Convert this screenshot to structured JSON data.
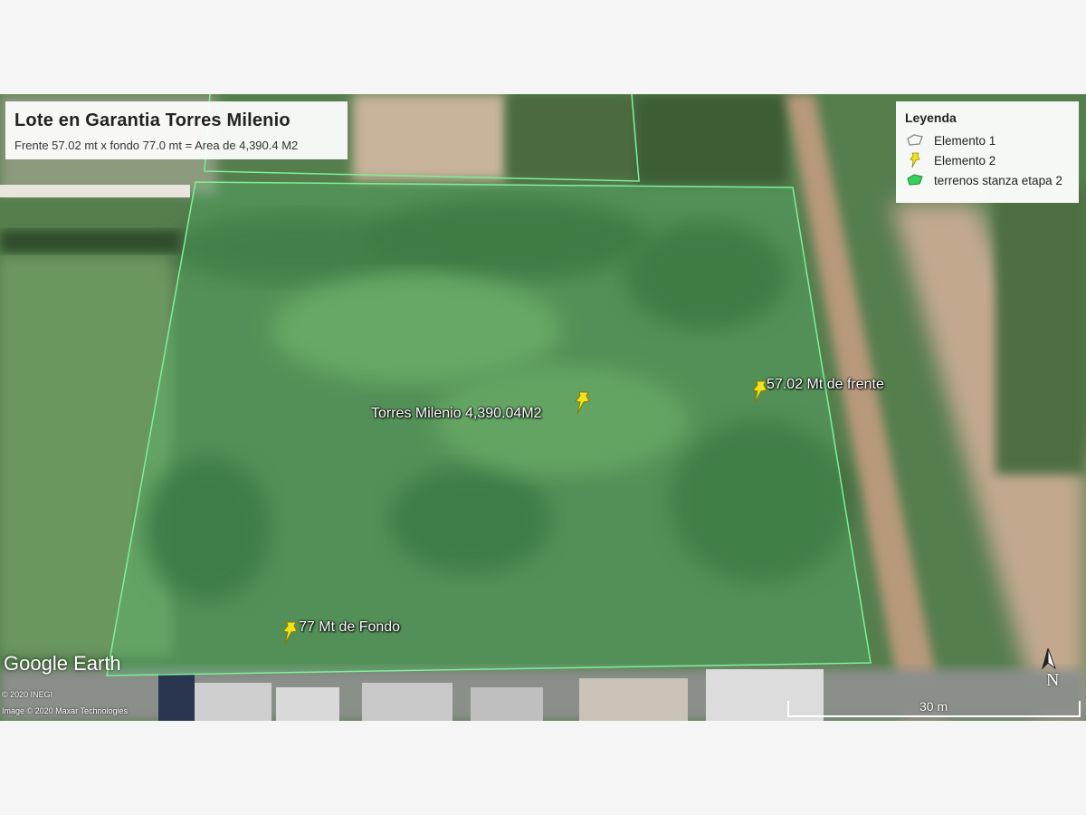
{
  "title_box": {
    "title": "Lote en Garantia Torres Milenio",
    "subtitle": "Frente 57.02 mt x fondo 77.0 mt = Area de 4,390.4 M2"
  },
  "legend": {
    "title": "Leyenda",
    "items": [
      {
        "label": "Elemento 1",
        "icon": "polygon-outline-icon"
      },
      {
        "label": "Elemento 2",
        "icon": "yellow-pushpin-icon"
      },
      {
        "label": "terrenos stanza etapa 2",
        "icon": "green-polygon-icon"
      }
    ]
  },
  "placemarks": [
    {
      "label": "Torres Milenio 4,390.04M2",
      "icon": "yellow-pushpin-icon"
    },
    {
      "label": "57.02 Mt de frente",
      "icon": "yellow-pushpin-icon"
    },
    {
      "label": "77 Mt de Fondo",
      "icon": "yellow-pushpin-icon"
    }
  ],
  "branding": {
    "brand_first": "Google",
    "brand_second": "Earth",
    "credit_1": "© 2020 INEGI",
    "credit_2": "Image © 2020 Maxar Technologies"
  },
  "scale": {
    "label": "30 m"
  },
  "compass": {
    "label": "N"
  },
  "colors": {
    "polygon_stroke": "#7CF09A",
    "polygon_fill": "#4fd07a",
    "pin": "#f2e21c"
  }
}
